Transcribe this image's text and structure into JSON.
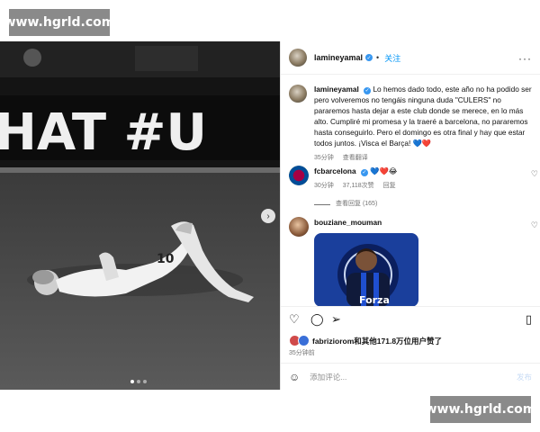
{
  "watermark": {
    "text": "www.hgrld.com"
  },
  "media": {
    "banner_text": "HAT #U",
    "jersey_number": "10",
    "carousel_dots": 3,
    "active_dot": 0
  },
  "header": {
    "username": "lamineyamal",
    "follow_label": "关注",
    "dot": "•"
  },
  "caption": {
    "username": "lamineyamal",
    "text": "Lo hemos dado todo, este año no ha podido ser pero volveremos no tengáis ninguna duda \"CULERS\" no pararemos hasta dejar a este club donde se merece, en lo más alto. Cumpliré mi promesa y la traeré a barcelona, no pararemos hasta conseguirlo. Pero el domingo es otra final y hay que estar todos juntos. ¡Visca el Barça! 💙❤️",
    "time": "35分钟",
    "translate": "查看翻译"
  },
  "comments": [
    {
      "username": "fcbarcelona",
      "text": "💙❤️😂",
      "time": "30分钟",
      "likes": "37,118次赞",
      "reply": "回复",
      "view_replies": "查看回复 (165)"
    },
    {
      "username": "bouziane_mouman",
      "image_text": "Forza"
    }
  ],
  "likes": {
    "text": "fabriziorom和其他171.8万位用户赞了"
  },
  "post_time": "35分钟前",
  "add_comment": {
    "placeholder": "添加评论...",
    "post_label": "发布"
  },
  "colors": {
    "accent": "#0095f6",
    "verified": "#3897f0"
  }
}
